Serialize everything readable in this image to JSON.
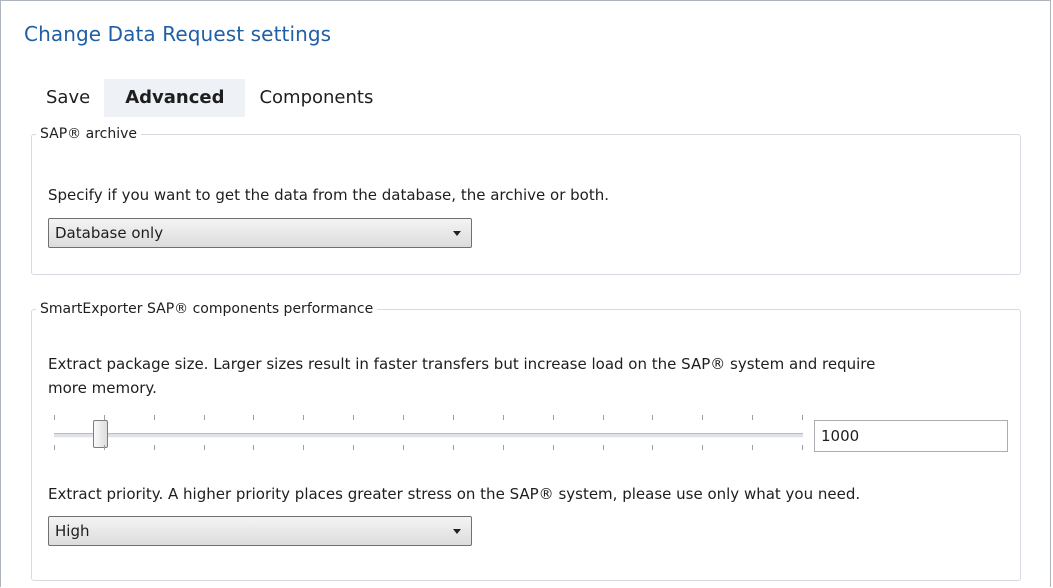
{
  "title": "Change Data Request settings",
  "tabs": [
    {
      "label": "Save",
      "active": false
    },
    {
      "label": "Advanced",
      "active": true
    },
    {
      "label": "Components",
      "active": false
    }
  ],
  "archive_group": {
    "legend": "SAP® archive",
    "description": "Specify if you want to get the data from the database, the archive or both.",
    "select_value": "Database only"
  },
  "performance_group": {
    "legend": "SmartExporter SAP® components performance",
    "package_description_line1": "Extract package size. Larger sizes result in faster transfers but increase load on the SAP® system and require",
    "package_description_line2": "more memory.",
    "package_size_value": "1000",
    "priority_description": "Extract priority. A higher priority places greater stress on the SAP® system, please use only what you need.",
    "priority_value": "High"
  },
  "colors": {
    "title": "#1f5fa6",
    "active_tab_bg": "#eef2f7",
    "group_border": "#d5dbe1"
  }
}
